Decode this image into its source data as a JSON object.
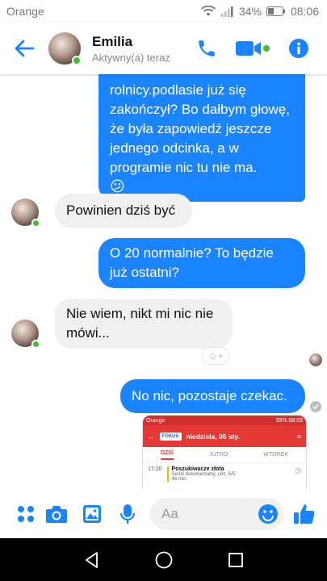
{
  "status_bar": {
    "carrier": "Orange",
    "battery": "34%",
    "time": "08:06"
  },
  "header": {
    "name": "Emilia",
    "status": "Aktywny(a) teraz"
  },
  "messages": {
    "m1": "rolnicy.podlasie już się zakończył? Bo dałbym głowę, że była zapowiedź jeszcze jednego odcinka, a w programie nic tu nie ma.",
    "m1_emoji": "😕",
    "m2": "Powinien dziś być",
    "m3": "O 20 normalnie? To będzie już ostatni?",
    "m4": "Nie wiem, nikt mi nic nie mówi...",
    "m5": "No nic, pozostaje czekac."
  },
  "thumbnail": {
    "carrier": "Orange",
    "status_right": "35% 08:03",
    "logo": "FOKUS",
    "date": "niedziela, 05 sty.",
    "tabs": [
      "DZIŚ",
      "JUTRO",
      "WTOREK"
    ],
    "time": "17:20",
    "show_title": "Poszukiwacze złota",
    "show_sub": "Serial dokumentalny, odc. 5/5",
    "show_dur": "46 min."
  },
  "composer": {
    "placeholder": "Aa"
  },
  "colors": {
    "messenger_blue": "#1a84ff",
    "online_green": "#44bd32"
  }
}
